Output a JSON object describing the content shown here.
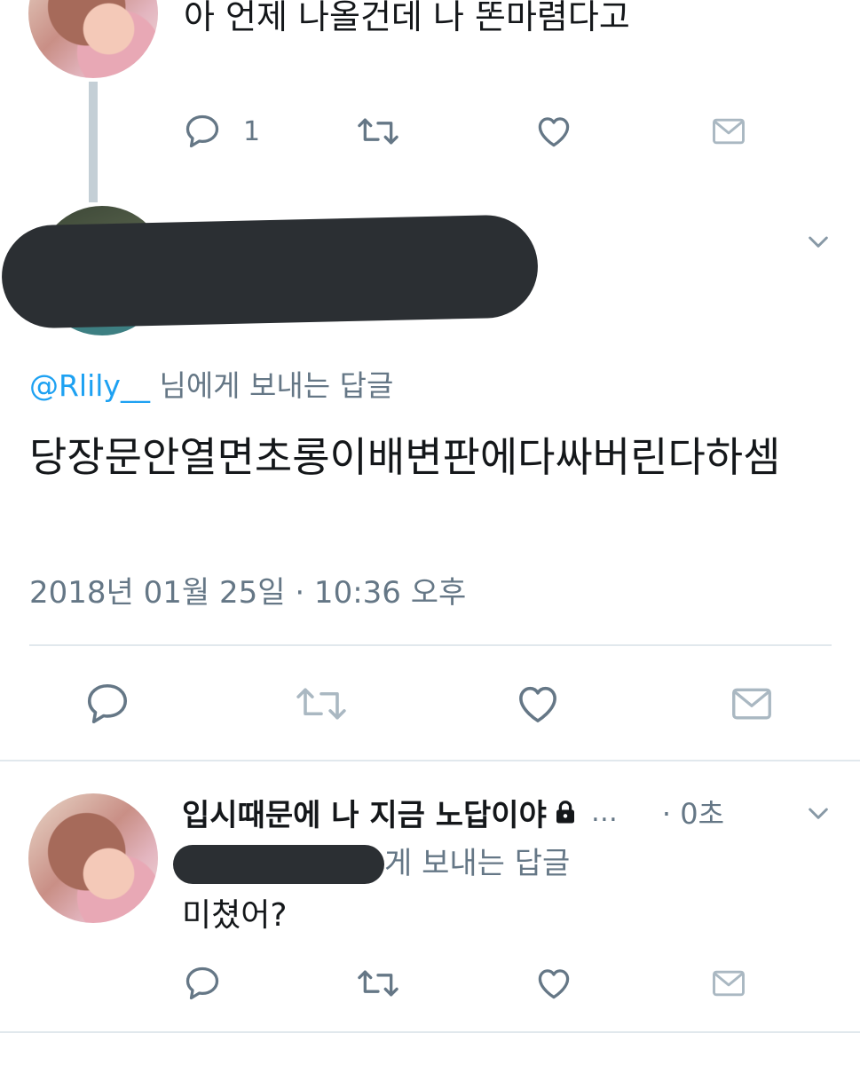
{
  "tweet1": {
    "text": "아 언제 나올건데 나 똔마렴다고",
    "reply_count": "1"
  },
  "main_tweet": {
    "reply_to_handle": "@Rlily__",
    "reply_to_suffix": " 님에게 보내는 답글",
    "text": "당장문안열면초롱이배변판에다싸버린다하셈",
    "timestamp": "2018년 01월 25일 · 10:36 오후"
  },
  "reply_tweet": {
    "display_name": "입시때문에 나 지금 노답이야",
    "ellipsis": "…",
    "time": "· 0초",
    "reply_to_suffix": "게 보내는 답글",
    "text": "미쳤어?"
  },
  "icons": {
    "reply": "reply-icon",
    "retweet": "retweet-icon",
    "like": "heart-icon",
    "dm": "mail-icon",
    "caret": "chevron-down-icon",
    "lock": "lock-icon"
  },
  "colors": {
    "icon_gray": "#657786",
    "icon_light": "#aab8c2",
    "mention_blue": "#1da1f2",
    "thread_line": "#c4cfd6",
    "divider": "#e1e8ed"
  }
}
